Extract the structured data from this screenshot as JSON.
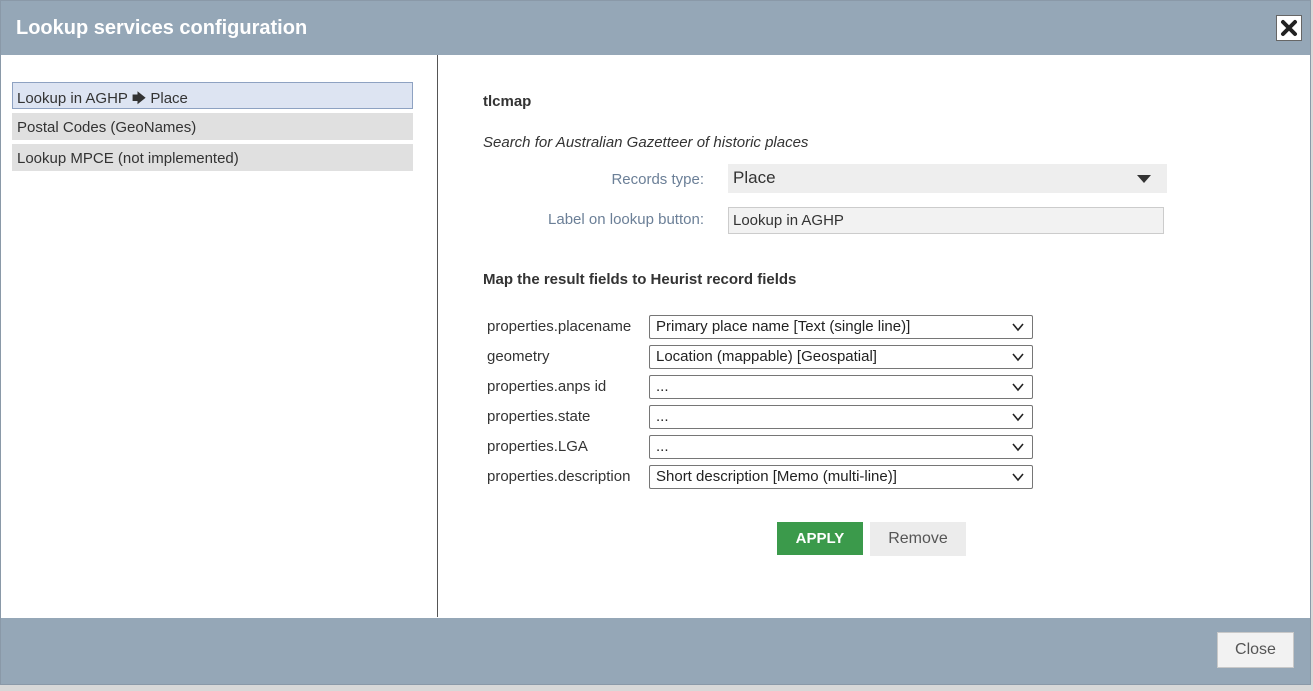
{
  "dialog": {
    "title": "Lookup services configuration",
    "close_icon": "close-x-icon"
  },
  "services": [
    {
      "label": "Lookup in AGHP",
      "arrow": "🡆",
      "target": "Place",
      "selected": true
    },
    {
      "label": "Postal Codes (GeoNames)",
      "selected": false
    },
    {
      "label": "Lookup MPCE (not implemented)",
      "selected": false
    }
  ],
  "config": {
    "service_name": "tlcmap",
    "description": "Search for Australian Gazetteer of historic places",
    "records_type_label": "Records type:",
    "records_type_value": "Place",
    "button_label_label": "Label on lookup button:",
    "button_label_value": "Lookup in AGHP",
    "map_heading": "Map the result fields to Heurist record fields",
    "mappings": [
      {
        "field": "properties.placename",
        "value": "Primary place name [Text (single line)]"
      },
      {
        "field": "geometry",
        "value": "Location (mappable) [Geospatial]"
      },
      {
        "field": "properties.anps id",
        "value": "..."
      },
      {
        "field": "properties.state",
        "value": "..."
      },
      {
        "field": "properties.LGA",
        "value": "..."
      },
      {
        "field": "properties.description",
        "value": "Short description [Memo (multi-line)]"
      }
    ],
    "apply_label": "APPLY",
    "remove_label": "Remove"
  },
  "footer": {
    "close_label": "Close"
  }
}
